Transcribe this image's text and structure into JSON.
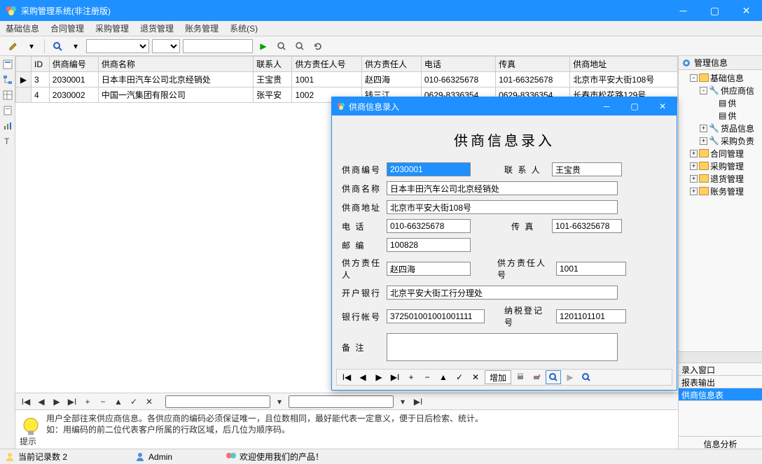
{
  "app": {
    "title": "采购管理系统(非注册版)"
  },
  "menu": [
    "基础信息",
    "合同管理",
    "采购管理",
    "退货管理",
    "账务管理",
    "系统(S)"
  ],
  "grid": {
    "headers": [
      "ID",
      "供商编号",
      "供商名称",
      "联系人",
      "供方责任人号",
      "供方责任人",
      "电话",
      "传真",
      "供商地址"
    ],
    "rows": [
      {
        "marker": "▶",
        "id": "3",
        "code": "2030001",
        "name": "日本丰田汽车公司北京经销处",
        "contact": "王宝贵",
        "resp_no": "1001",
        "resp": "赵四海",
        "tel": "010-66325678",
        "fax": "101-66325678",
        "addr": "北京市平安大街108号"
      },
      {
        "marker": "",
        "id": "4",
        "code": "2030002",
        "name": "中国一汽集团有限公司",
        "contact": "张平安",
        "resp_no": "1002",
        "resp": "钱三江",
        "tel": "0629-8336354",
        "fax": "0629-8336354",
        "addr": "长春市松花路129号"
      }
    ]
  },
  "hint": {
    "line1": "用户全部往来供应商信息。各供应商的编码必须保证唯一，且位数相同，最好能代表一定意义，便于日后检索、统计。",
    "line2": "如：用编码的前二位代表客户所属的行政区域，后几位为顺序码。",
    "label": "提示"
  },
  "tree": {
    "header": "管理信息",
    "nodes": [
      {
        "level": 1,
        "exp": "-",
        "icon": "folder",
        "label": "基础信息"
      },
      {
        "level": 2,
        "exp": "-",
        "icon": "wrench",
        "label": "供应商信"
      },
      {
        "level": 3,
        "exp": "",
        "icon": "doc",
        "label": "供"
      },
      {
        "level": 3,
        "exp": "",
        "icon": "doc",
        "label": "供"
      },
      {
        "level": 2,
        "exp": "+",
        "icon": "wrench",
        "label": "货品信息"
      },
      {
        "level": 2,
        "exp": "+",
        "icon": "wrench",
        "label": "采购负责"
      },
      {
        "level": 1,
        "exp": "+",
        "icon": "folder",
        "label": "合同管理"
      },
      {
        "level": 1,
        "exp": "+",
        "icon": "folder",
        "label": "采购管理"
      },
      {
        "level": 1,
        "exp": "+",
        "icon": "folder",
        "label": "退货管理"
      },
      {
        "level": 1,
        "exp": "+",
        "icon": "folder",
        "label": "账务管理"
      }
    ],
    "tabs": [
      "录入窗口",
      "报表输出",
      "供商信息表"
    ],
    "active_tab": 2,
    "info_label": "信息分析"
  },
  "status": {
    "records": "当前记录数 2",
    "user": "Admin",
    "welcome": "欢迎使用我们的产品！"
  },
  "dialog": {
    "title": "供商信息录入",
    "heading": "供商信息录入",
    "labels": {
      "code": "供商编号",
      "contact": "联 系 人",
      "name": "供商名称",
      "addr": "供商地址",
      "tel": "电    话",
      "fax": "传    真",
      "zip": "邮    编",
      "resp": "供方责任人",
      "resp_no": "供方责任人号",
      "bank": "开户银行",
      "acct": "银行帐号",
      "taxno": "纳税登记号",
      "remark": "备    注"
    },
    "values": {
      "code": "2030001",
      "contact": "王宝贵",
      "name": "日本丰田汽车公司北京经销处",
      "addr": "北京市平安大街108号",
      "tel": "010-66325678",
      "fax": "101-66325678",
      "zip": "100828",
      "resp": "赵四海",
      "resp_no": "1001",
      "bank": "北京平安大街工行分理处",
      "acct": "372501001001001111",
      "taxno": "1201101101",
      "remark": ""
    },
    "btn_add": "增加"
  }
}
